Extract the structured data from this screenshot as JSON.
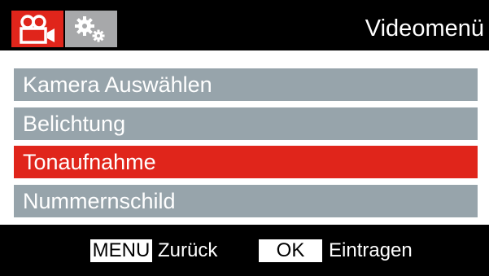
{
  "header": {
    "title": "Videomenü",
    "tabs": [
      {
        "icon": "video-camera-icon",
        "active": true
      },
      {
        "icon": "gears-icon",
        "active": false
      }
    ]
  },
  "menu": {
    "items": [
      {
        "label": "Kamera Auswählen",
        "selected": false
      },
      {
        "label": "Belichtung",
        "selected": false
      },
      {
        "label": "Tonaufnahme",
        "selected": true
      },
      {
        "label": "Nummernschild",
        "selected": false
      }
    ]
  },
  "footer": {
    "menu_key": "MENU",
    "menu_action": "Zurück",
    "ok_key": "OK",
    "ok_action": "Eintragen"
  },
  "colors": {
    "accent_red": "#e0251b",
    "item_grey": "#97a4ab",
    "bar_black": "#000000"
  }
}
